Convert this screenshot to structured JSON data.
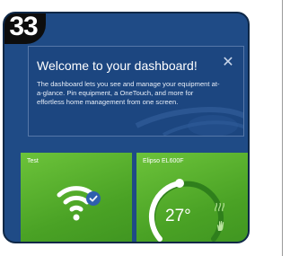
{
  "step_badge": "33",
  "welcome": {
    "title": "Welcome to your dashboard!",
    "body": "The dashboard lets you see and manage your equipment at-a-glance. Pin equipment, a OneTouch, and more for effortless home management from one screen.",
    "close_icon": "close-icon"
  },
  "tiles": [
    {
      "label": "Test",
      "icon": "wifi-icon",
      "status_icon": "checkmark-icon"
    },
    {
      "label": "Elipso EL600F",
      "temperature": "27°",
      "icons": [
        "heat-wave-icon",
        "hand-icon"
      ]
    }
  ],
  "colors": {
    "panel": "#1f4b86",
    "tile_green": "#4aa225",
    "check_badge": "#2f5fae"
  }
}
